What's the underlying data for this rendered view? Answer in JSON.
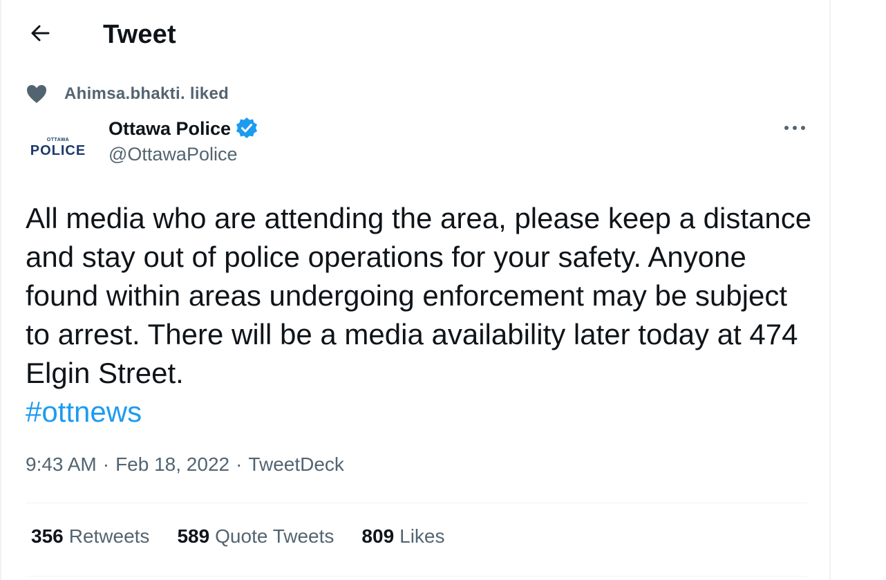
{
  "header": {
    "title": "Tweet",
    "back_icon": "arrow-left-icon"
  },
  "social_context": {
    "icon": "heart-icon",
    "text": "Ahimsa.bhakti. liked"
  },
  "author": {
    "avatar_small_text": "OTTAWA",
    "avatar_big_text": "POLICE",
    "display_name": "Ottawa Police",
    "verified_icon": "verified-badge-icon",
    "handle": "@OttawaPolice",
    "more_icon": "more-horizontal-icon"
  },
  "tweet": {
    "text": "All media who are attending the area, please keep a distance and stay out of police operations for your safety. Anyone found within areas undergoing enforcement may be subject to arrest. There will be a media availability later today at 474 Elgin Street.",
    "hashtag": "#ottnews"
  },
  "meta": {
    "time": "9:43 AM",
    "date": "Feb 18, 2022",
    "source": "TweetDeck",
    "separator": "·"
  },
  "stats": {
    "retweets_count": "356",
    "retweets_label": "Retweets",
    "quotes_count": "589",
    "quotes_label": "Quote Tweets",
    "likes_count": "809",
    "likes_label": "Likes"
  },
  "colors": {
    "accent": "#1d9bf0",
    "secondary_text": "#536471",
    "primary_text": "#0f1419",
    "divider": "#eff3f4"
  }
}
